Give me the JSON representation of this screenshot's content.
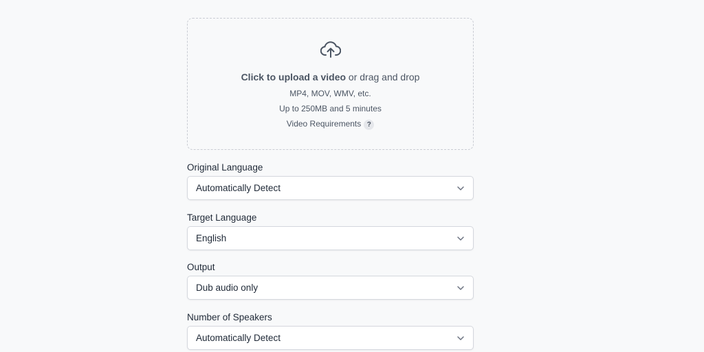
{
  "upload": {
    "icon": "cloud-upload-icon",
    "title_strong": "Click to upload a video",
    "title_rest": " or drag and drop",
    "formats": "MP4, MOV, WMV, etc.",
    "limits": "Up to 250MB and 5 minutes",
    "requirements_label": "Video Requirements",
    "help_glyph": "?"
  },
  "fields": {
    "original_language": {
      "label": "Original Language",
      "value": "Automatically Detect"
    },
    "target_language": {
      "label": "Target Language",
      "value": "English"
    },
    "output": {
      "label": "Output",
      "value": "Dub audio only"
    },
    "speakers": {
      "label": "Number of Speakers",
      "value": "Automatically Detect"
    }
  },
  "icons": {
    "dropdown": "chevron-down-icon"
  }
}
